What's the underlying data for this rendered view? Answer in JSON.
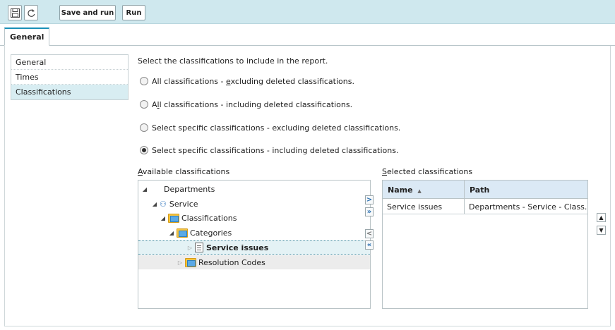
{
  "toolbar": {
    "save_icon": "save-icon",
    "refresh_icon": "refresh-icon",
    "save_and_run_label": "Save and run",
    "run_label": "Run"
  },
  "tabs": [
    {
      "label": "General"
    }
  ],
  "sidebar": {
    "items": [
      {
        "label": "General"
      },
      {
        "label": "Times"
      },
      {
        "label": "Classifications",
        "active": true
      }
    ]
  },
  "main": {
    "instruction": "Select the classifications to include in the report.",
    "options": [
      {
        "pre": "All classifications - ",
        "u": "e",
        "post": "xcluding deleted classifications.",
        "checked": false
      },
      {
        "pre": "A",
        "u": "l",
        "post": "l classifications - including deleted classifications.",
        "checked": false
      },
      {
        "pre": "Select specific classifications - excluding deleted classifications.",
        "u": "",
        "post": "",
        "checked": false
      },
      {
        "pre": "Select specific classifications - including deleted classifications.",
        "u": "",
        "post": "",
        "checked": true
      }
    ],
    "available": {
      "label_u": "A",
      "label_rest": "vailable classifications",
      "tree": [
        {
          "label": "Departments",
          "level": 0,
          "icon": "none",
          "expanded": true
        },
        {
          "label": "Service",
          "level": 1,
          "icon": "org-chart-icon",
          "expanded": true
        },
        {
          "label": "Classifications",
          "level": 2,
          "icon": "folder-icon",
          "expanded": true
        },
        {
          "label": "Categories",
          "level": 3,
          "icon": "folder-icon",
          "expanded": true
        },
        {
          "label": "Service issues",
          "level": 4,
          "icon": "document-icon",
          "expanded": false,
          "selected": true
        },
        {
          "label": "Resolution Codes",
          "level": 3,
          "icon": "folder-icon",
          "expanded": false,
          "hover": true
        }
      ]
    },
    "move_buttons": {
      "add_one": ">",
      "add_all": "»",
      "remove_one": "<",
      "remove_all": "«"
    },
    "selected": {
      "label_u": "S",
      "label_rest": "elected classifications",
      "columns": [
        "Name",
        "Path"
      ],
      "sort_indicator": "▲",
      "rows": [
        {
          "name": "Service issues",
          "path": "Departments - Service - Class..."
        }
      ]
    },
    "order_buttons": {
      "up": "▲",
      "down": "▼"
    }
  },
  "colors": {
    "toolbar_bg": "#cfe8ee",
    "active_tab_accent": "#1a90b8",
    "active_nav_bg": "#d8edf2",
    "grid_header_bg": "#dbe9f5"
  }
}
